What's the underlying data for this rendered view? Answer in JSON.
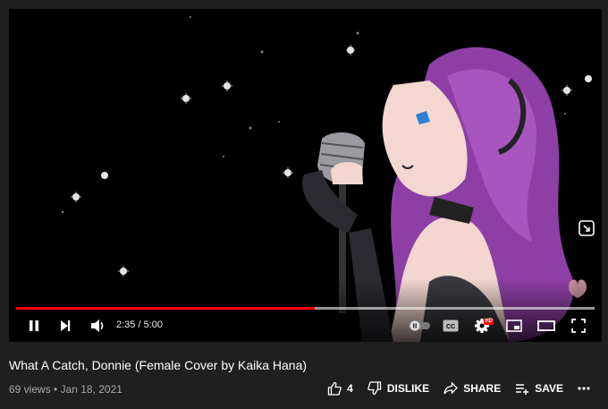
{
  "video": {
    "current_time": "2:35",
    "duration": "5:00",
    "time_display": "2:35 / 5:00",
    "played_fraction": 0.517,
    "buffered_fraction": 1.0,
    "hd_badge": "HD",
    "cc_label": "CC",
    "accent_color": "#ff0000"
  },
  "info": {
    "title": "What A Catch, Donnie (Female Cover by Kaika Hana)",
    "views": "69 views",
    "date": "Jan 18, 2021",
    "meta_line": "69 views • Jan 18, 2021"
  },
  "actions": {
    "like_count": "4",
    "dislike_label": "DISLIKE",
    "share_label": "SHARE",
    "save_label": "SAVE"
  },
  "icons": {
    "pause": "pause-icon",
    "next": "next-icon",
    "volume": "volume-icon",
    "autoplay": "autoplay-toggle-icon",
    "captions": "captions-icon",
    "settings": "gear-icon",
    "miniplayer": "miniplayer-icon",
    "theater": "theater-mode-icon",
    "fullscreen": "fullscreen-icon",
    "like": "thumbs-up-icon",
    "dislike": "thumbs-down-icon",
    "share": "share-icon",
    "save": "playlist-add-icon",
    "more": "more-icon"
  }
}
